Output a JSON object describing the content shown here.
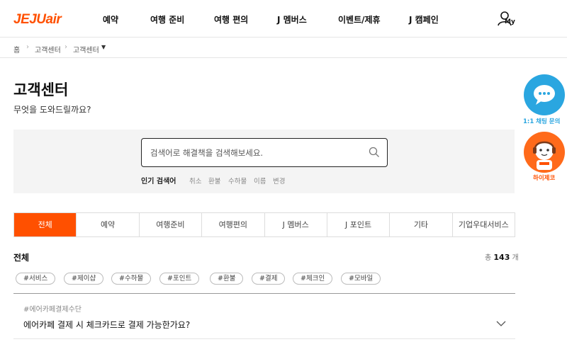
{
  "header": {
    "logo_main": "JEJU",
    "logo_air": "air",
    "nav": [
      "예약",
      "여행 준비",
      "여행 편의",
      "J 멤버스",
      "이벤트/제휴",
      "J 캠페인"
    ],
    "my_label": "My"
  },
  "breadcrumb": [
    "홈",
    "고객센터",
    "고객센터"
  ],
  "page": {
    "title": "고객센터",
    "subtitle": "무엇을 도와드릴까요?"
  },
  "search": {
    "placeholder": "검색어로 해결책을 검색해보세요.",
    "popular_label": "인기 검색어",
    "keywords": [
      "취소",
      "환불",
      "수하물",
      "이름",
      "변경"
    ]
  },
  "tabs": [
    "전체",
    "예약",
    "여행준비",
    "여행편의",
    "J 멤버스",
    "J 포인트",
    "기타",
    "기업우대서비스"
  ],
  "active_tab": "전체",
  "section": {
    "title": "전체",
    "total_prefix": "총",
    "total_count": "143",
    "total_suffix": "개"
  },
  "hashtags": [
    "#서비스",
    "#제이샵",
    "#수하물",
    "#포인트",
    "#환불",
    "#결제",
    "#체크인",
    "#모바일"
  ],
  "faq": [
    {
      "category": "#에어카페결제수단",
      "question": "에어카페 결제 시 체크카드로 결제 가능한가요?"
    }
  ],
  "floating": {
    "chat_label": "1:1 채팅 문의",
    "bot_label": "하이제코"
  },
  "colors": {
    "brand": "#ff5000",
    "chat": "#2aa6e0"
  }
}
